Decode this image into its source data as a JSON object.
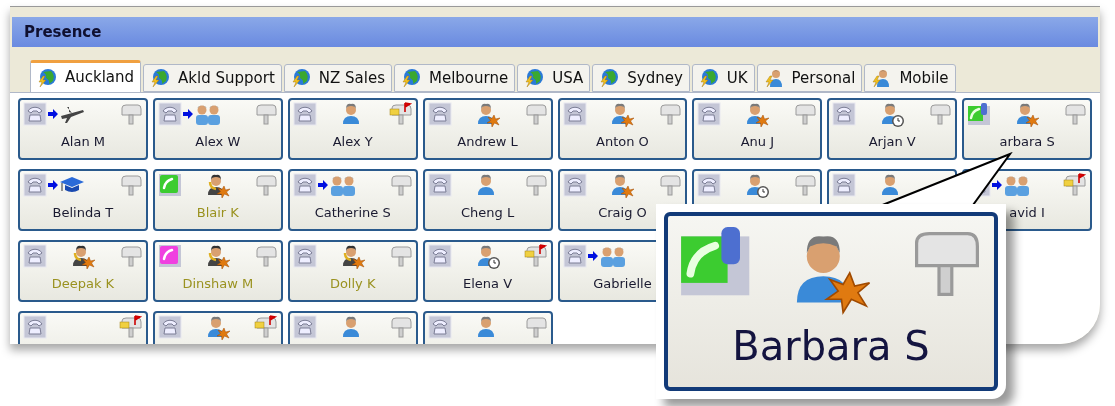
{
  "panel": {
    "title": "Presence"
  },
  "tabs": [
    {
      "label": "Auckland",
      "selected": true,
      "kind": "globe"
    },
    {
      "label": "Akld Support",
      "selected": false,
      "kind": "globe"
    },
    {
      "label": "NZ Sales",
      "selected": false,
      "kind": "globe"
    },
    {
      "label": "Melbourne",
      "selected": false,
      "kind": "globe"
    },
    {
      "label": "USA",
      "selected": false,
      "kind": "globe"
    },
    {
      "label": "Sydney",
      "selected": false,
      "kind": "globe"
    },
    {
      "label": "UK",
      "selected": false,
      "kind": "globe"
    },
    {
      "label": "Personal",
      "selected": false,
      "kind": "person"
    },
    {
      "label": "Mobile",
      "selected": false,
      "kind": "person"
    }
  ],
  "rows": [
    [
      {
        "name": "Alan M",
        "dimmed": false,
        "phone": {
          "kind": "idle"
        },
        "divert": {
          "kind": "plane"
        },
        "mailbox": {
          "kind": "empty"
        }
      },
      {
        "name": "Alex W",
        "dimmed": false,
        "phone": {
          "kind": "idle"
        },
        "divert": {
          "kind": "group"
        },
        "mailbox": {
          "kind": "empty"
        }
      },
      {
        "name": "Alex Y",
        "dimmed": false,
        "phone": {
          "kind": "idle"
        },
        "presence": {
          "kind": "plain"
        },
        "mailbox": {
          "kind": "flag"
        }
      },
      {
        "name": "Andrew L",
        "dimmed": false,
        "phone": {
          "kind": "idle"
        },
        "presence": {
          "kind": "star"
        },
        "mailbox": {
          "kind": "empty"
        }
      },
      {
        "name": "Anton O",
        "dimmed": false,
        "phone": {
          "kind": "idle"
        },
        "presence": {
          "kind": "star"
        },
        "mailbox": {
          "kind": "empty"
        }
      },
      {
        "name": "Anu J",
        "dimmed": false,
        "phone": {
          "kind": "idle"
        },
        "presence": {
          "kind": "star"
        },
        "mailbox": {
          "kind": "empty"
        }
      },
      {
        "name": "Arjan V",
        "dimmed": false,
        "phone": {
          "kind": "idle"
        },
        "presence": {
          "kind": "clock"
        },
        "mailbox": {
          "kind": "empty"
        }
      },
      {
        "name": "arbara S",
        "dimmed": false,
        "phone": {
          "kind": "mobile"
        },
        "presence": {
          "kind": "star"
        },
        "mailbox": {
          "kind": "empty"
        }
      }
    ],
    [
      {
        "name": "Belinda T",
        "dimmed": false,
        "phone": {
          "kind": "idle"
        },
        "divert": {
          "kind": "cap"
        },
        "mailbox": {
          "kind": "empty"
        }
      },
      {
        "name": "Blair K",
        "dimmed": true,
        "phone": {
          "kind": "green"
        },
        "presence": {
          "kind": "headset"
        },
        "mailbox": {
          "kind": "empty"
        }
      },
      {
        "name": "Catherine S",
        "dimmed": false,
        "phone": {
          "kind": "idle"
        },
        "divert": {
          "kind": "group"
        },
        "mailbox": {
          "kind": "empty"
        }
      },
      {
        "name": "Cheng L",
        "dimmed": false,
        "phone": {
          "kind": "idle"
        },
        "presence": {
          "kind": "plain"
        },
        "mailbox": {
          "kind": "empty"
        }
      },
      {
        "name": "Craig O",
        "dimmed": false,
        "phone": {
          "kind": "idle"
        },
        "presence": {
          "kind": "star"
        },
        "mailbox": {
          "kind": "empty"
        }
      },
      {
        "phone": {
          "kind": "idle"
        },
        "presence": {
          "kind": "clock"
        },
        "mailbox": {
          "kind": "empty"
        }
      },
      {
        "phone": {
          "kind": "idle"
        },
        "presence": {
          "kind": "plain"
        }
      },
      {
        "name": "avid I",
        "dimmed": false,
        "phone": {
          "kind": "idle"
        },
        "divert": {
          "kind": "group"
        },
        "mailbox": {
          "kind": "flag"
        }
      }
    ],
    [
      {
        "name": "Deepak K",
        "dimmed": true,
        "phone": {
          "kind": "idle"
        },
        "presence": {
          "kind": "headset"
        },
        "mailbox": {
          "kind": "empty"
        }
      },
      {
        "name": "Dinshaw M",
        "dimmed": true,
        "phone": {
          "kind": "pink"
        },
        "presence": {
          "kind": "headset"
        },
        "mailbox": {
          "kind": "empty"
        }
      },
      {
        "name": "Dolly K",
        "dimmed": true,
        "phone": {
          "kind": "idle"
        },
        "presence": {
          "kind": "headset"
        },
        "mailbox": {
          "kind": "empty"
        }
      },
      {
        "name": "Elena V",
        "dimmed": false,
        "phone": {
          "kind": "idle"
        },
        "presence": {
          "kind": "clock"
        },
        "mailbox": {
          "kind": "flag"
        }
      },
      {
        "name": "Gabrielle",
        "dimmed": false,
        "phone": {
          "kind": "idle"
        },
        "divert": {
          "kind": "group"
        }
      }
    ],
    [
      {
        "phone": {
          "kind": "idle"
        },
        "mailbox": {
          "kind": "flag"
        }
      },
      {
        "phone": {
          "kind": "idle"
        },
        "presence": {
          "kind": "star"
        },
        "mailbox": {
          "kind": "flag"
        }
      },
      {
        "phone": {
          "kind": "idle"
        },
        "presence": {
          "kind": "plain"
        },
        "mailbox": {
          "kind": "empty"
        }
      },
      {
        "phone": {
          "kind": "idle"
        },
        "presence": {
          "kind": "plain"
        },
        "mailbox": {
          "kind": "empty"
        }
      }
    ]
  ],
  "callout": {
    "name": "Barbara S",
    "phone": {
      "kind": "mobile"
    },
    "presence": {
      "kind": "star"
    },
    "mailbox": {
      "kind": "empty"
    }
  }
}
